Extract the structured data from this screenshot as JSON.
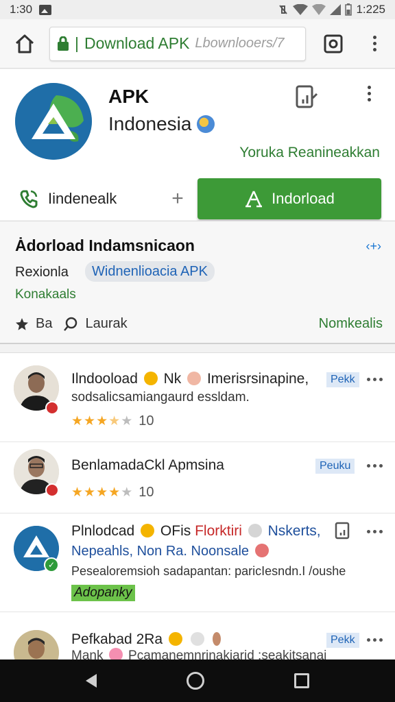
{
  "status_bar": {
    "time": "1:30",
    "right_time": "1:225"
  },
  "browser": {
    "url_main": "Download APK",
    "url_separator": "|",
    "url_path": "Lbownlooers/7"
  },
  "app": {
    "title": "APK",
    "subtitle": "Indonesia",
    "publisher": "Yoruka Reanineakkan",
    "call_label": "Iindenealk",
    "plus_label": "+",
    "install_label": "Indorload"
  },
  "info": {
    "title": "Ȧdorload Indamsnicaon",
    "arrow": "‹+›",
    "chip_plain": "Rexionla",
    "chip_blue": "Widnenlioacia APK",
    "link": "Konakaals",
    "meta_star_label": "Ba",
    "meta_search_label": "Laurak",
    "right_label": "Nomkealis"
  },
  "reviews": [
    {
      "title_a": "Ilndooload",
      "title_b": "Nk",
      "title_c": "Imerisrsinapine,",
      "subtitle": "sodsalicsamiangaurd essldam.",
      "tag": "Pekk",
      "stars": 3.5,
      "rating": "10"
    },
    {
      "title_a": "BenlamadaCkl Apmsina",
      "tag": "Peuku",
      "stars": 4,
      "rating": "10"
    },
    {
      "title_a": "Plnlodcad",
      "title_b": "OFis",
      "title_red": "Florktiri",
      "title_c": "Nskerts,",
      "line2": "Nepeahls, Non Ra. Noonsale",
      "line3": "Pesealoremsioh sadapantan: paricIesndn.I /oushe",
      "green_tag": "Adopanky"
    },
    {
      "title_a": "Pefkabad 2Ra",
      "tag": "Pekk",
      "line2": "Mank",
      "line2b": "Pcamanemnrinakiarid :seakitsanai"
    }
  ],
  "colors": {
    "accent_green": "#3d9a37",
    "link_blue": "#1e63b6"
  }
}
